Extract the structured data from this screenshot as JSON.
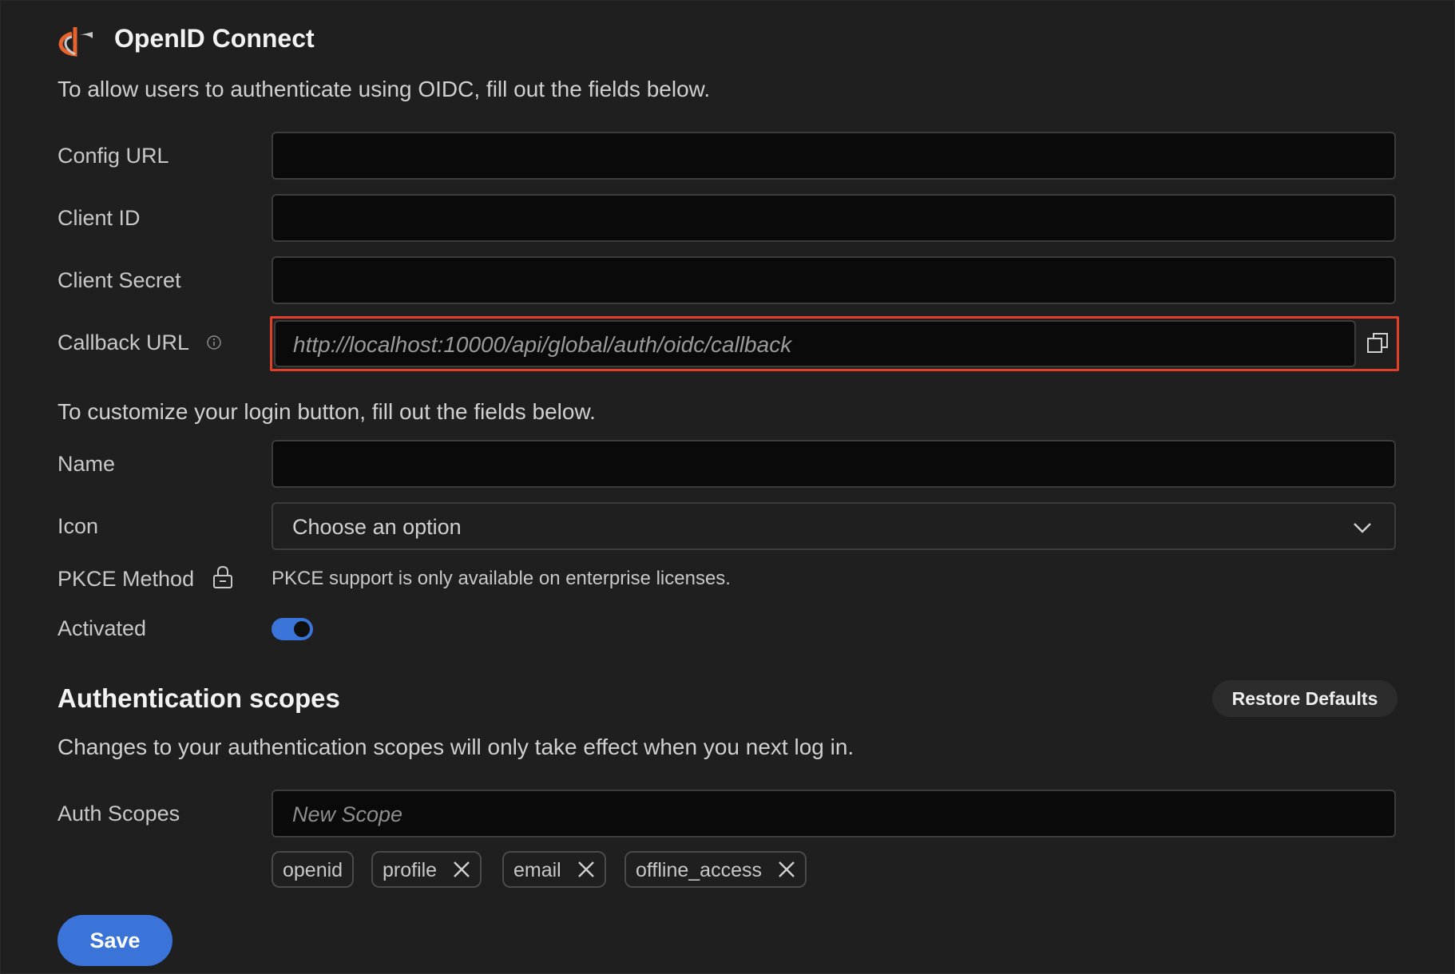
{
  "header": {
    "title": "OpenID Connect",
    "logo_icon": "openid-logo-icon",
    "description": "To allow users to authenticate using OIDC, fill out the fields below."
  },
  "fields": {
    "config_url_label": "Config URL",
    "client_id_label": "Client ID",
    "client_secret_label": "Client Secret",
    "callback_url_label": "Callback URL",
    "callback_url_value": "http://localhost:10000/api/global/auth/oidc/callback"
  },
  "login_button": {
    "description": "To customize your login button, fill out the fields below.",
    "name_label": "Name",
    "icon_label": "Icon",
    "icon_select_value": "Choose an option",
    "pkce_label": "PKCE Method",
    "pkce_note": "PKCE support is only available on enterprise licenses.",
    "activated_label": "Activated",
    "activated": true
  },
  "scopes": {
    "heading": "Authentication scopes",
    "restore_label": "Restore Defaults",
    "description": "Changes to your authentication scopes will only take effect when you next log in.",
    "auth_scopes_label": "Auth Scopes",
    "new_scope_placeholder": "New Scope",
    "chips": [
      "openid",
      "profile",
      "email",
      "offline_access"
    ]
  },
  "actions": {
    "save_label": "Save"
  },
  "colors": {
    "accent": "#3a74d8",
    "highlight": "#e0402a",
    "logo": "#e8622c"
  }
}
